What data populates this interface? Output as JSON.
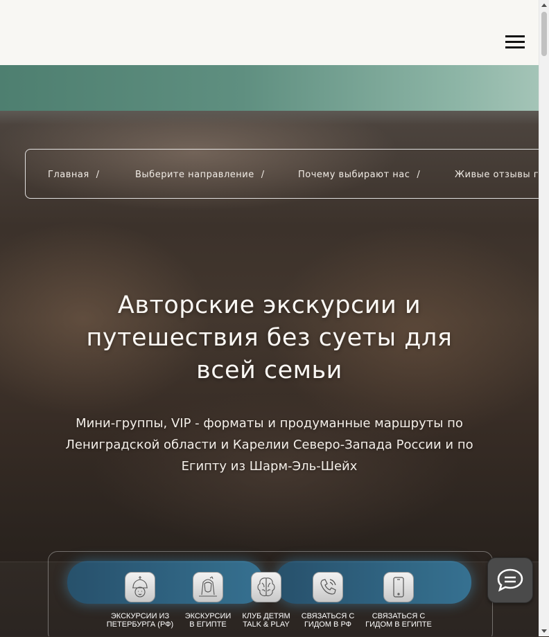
{
  "header": {
    "menu_icon": "hamburger-menu-icon"
  },
  "breadcrumb": {
    "items": [
      "Главная",
      "Выберите направление",
      "Почему выбирают нас",
      "Живые отзывы гостей"
    ],
    "separator": "/"
  },
  "hero": {
    "title": "Авторские экскурсии и путешествия без суеты для всей семьи",
    "subtitle": "Мини-группы, VIP - форматы и продуманные маршруты по Лениградской области и Карелии Северо-Запада России и по Египту из Шарм-Эль-Шейх"
  },
  "bottom_nav": {
    "items": [
      {
        "line1": "Экскурсии из",
        "line2": "Петербурга (РФ)",
        "icon": "church-dome-icon"
      },
      {
        "line1": "Экскурсии",
        "line2": "в Египте",
        "icon": "pharaoh-icon"
      },
      {
        "line1": "Клуб детям",
        "line2": "Talk & Play",
        "icon": "brain-icon"
      },
      {
        "line1": "Связаться с",
        "line2": "гидом в РФ",
        "icon": "phone-call-icon"
      },
      {
        "line1": "Связаться с",
        "line2": "гидом в Египте",
        "icon": "smartphone-icon"
      }
    ]
  },
  "chat": {
    "icon": "chat-bubble-icon"
  },
  "colors": {
    "header_bg": "#f8f7f3",
    "band_green": "#5f8f80",
    "cta_blue": "#2e6c8d",
    "text_light": "#fbf8f4"
  }
}
